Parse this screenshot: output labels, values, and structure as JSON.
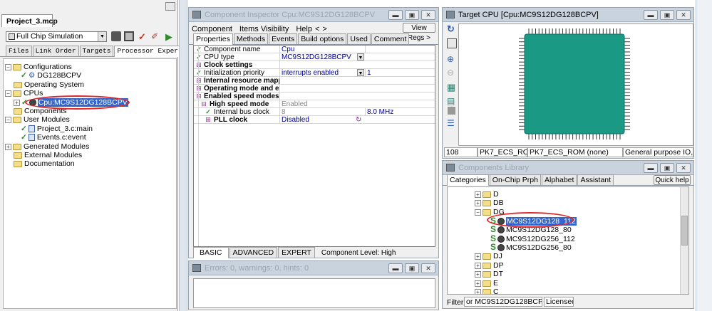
{
  "project": {
    "tab": "Project_3.mcp",
    "target_select": "Full Chip Simulation",
    "tabs": [
      "Files",
      "Link Order",
      "Targets",
      "Processor Expert"
    ],
    "tree": [
      "Configurations",
      "DG128BCPV",
      "Operating System",
      "CPUs",
      "Cpu:MC9S12DG128BCPV",
      "Components",
      "User Modules",
      "Project_3.c:main",
      "Events.c:event",
      "Generated Modules",
      "External Modules",
      "Documentation"
    ]
  },
  "inspector": {
    "title": "Component Inspector Cpu:MC9S12DG128BCPV",
    "menu": [
      "Component",
      "Items Visibility",
      "Help",
      "<",
      ">"
    ],
    "view_regs": "View Regs >",
    "tabs": [
      "Properties",
      "Methods",
      "Events",
      "Build options",
      "Used",
      "Comment"
    ],
    "rows": [
      {
        "name": "Component name",
        "value": "Cpu",
        "extra": ""
      },
      {
        "name": "CPU type",
        "value": "MC9S12DG128BCPV",
        "extra": ""
      },
      {
        "name": "Clock settings",
        "value": "",
        "extra": ""
      },
      {
        "name": "Initialization priority",
        "value": "interrupts enabled",
        "extra": "1"
      },
      {
        "name": "Internal resource mapping",
        "value": "",
        "extra": ""
      },
      {
        "name": "Operating mode and exte",
        "value": "",
        "extra": ""
      },
      {
        "name": "Enabled speed modes",
        "value": "",
        "extra": ""
      },
      {
        "name": "High speed mode",
        "value": "Enabled",
        "extra": ""
      },
      {
        "name": "Internal bus clock",
        "value": "8",
        "extra": "8.0 MHz"
      },
      {
        "name": "PLL clock",
        "value": "Disabled",
        "extra": ""
      }
    ],
    "level_tabs": [
      "BASIC",
      "ADVANCED",
      "EXPERT"
    ],
    "component_level": "Component Level: High"
  },
  "errors": {
    "title": "Errors: 0, warnings: 0, hints: 0"
  },
  "target_cpu": {
    "title": "Target CPU [Cpu:MC9S12DG128BCPV]",
    "status": [
      "108",
      "PK7_ECS_ROM",
      "PK7_ECS_ROM (none)",
      "General purpose IO,"
    ],
    "chip_color": "#1a9a85"
  },
  "library": {
    "title": "Components Library",
    "tabs": [
      "Categories",
      "On-Chip Prph",
      "Alphabet",
      "Assistant"
    ],
    "quick_help": "Quick help >",
    "items": [
      "D",
      "DB",
      "DG",
      "MC9S12DG128_112",
      "MC9S12DG128_80",
      "MC9S12DG256_112",
      "MC9S12DG256_80",
      "DJ",
      "DP",
      "DT",
      "E",
      "C"
    ],
    "filter_label": "Filter:",
    "filter_value": "or MC9S12DG128BCPV onl",
    "licensed": "Licensed"
  },
  "colors": {
    "highlight": "#3366cc",
    "annotation": "#e0262b"
  }
}
